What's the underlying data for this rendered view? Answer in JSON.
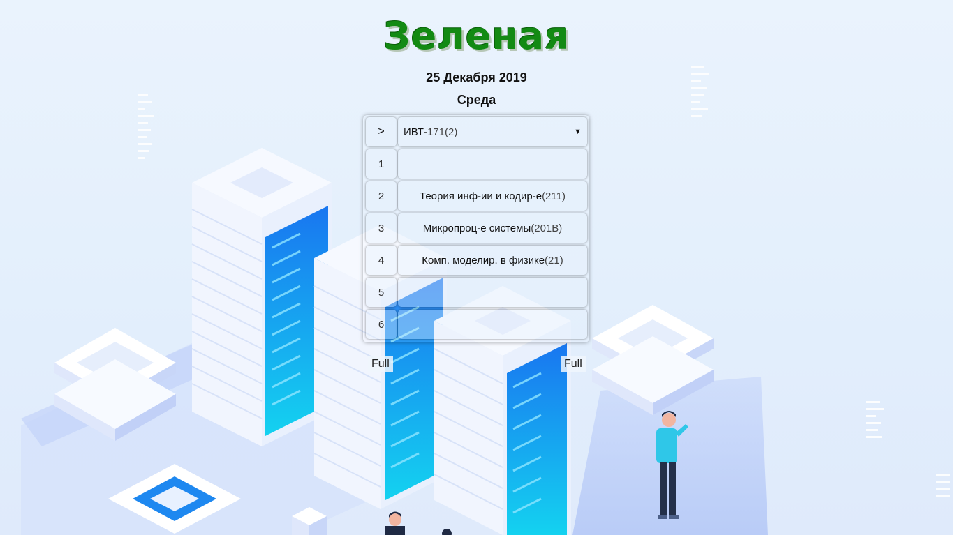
{
  "header": {
    "title": "Зеленая",
    "date": "25 Декабря 2019",
    "weekday": "Среда"
  },
  "selector": {
    "button_label": ">",
    "group_prefix": "ИВТ-",
    "group_suffix": "171(2)",
    "dropdown_icon": "triangle-down-icon"
  },
  "schedule": {
    "rows": [
      {
        "num": "1",
        "subject": "",
        "room": ""
      },
      {
        "num": "2",
        "subject": "Теория инф-ии и кодир-е",
        "room": "(211)"
      },
      {
        "num": "3",
        "subject": "Микропроц-е системы",
        "room": "(201В)"
      },
      {
        "num": "4",
        "subject": "Комп. моделир. в физике",
        "room": "(21)"
      },
      {
        "num": "5",
        "subject": "",
        "room": ""
      },
      {
        "num": "6",
        "subject": "",
        "room": ""
      }
    ]
  },
  "buttons": {
    "full_left": "Full",
    "full_right": "Full"
  },
  "colors": {
    "title": "#138a13",
    "background": "#e3effc",
    "server_blue": "#1e90ff",
    "server_cyan": "#17c6f0"
  }
}
